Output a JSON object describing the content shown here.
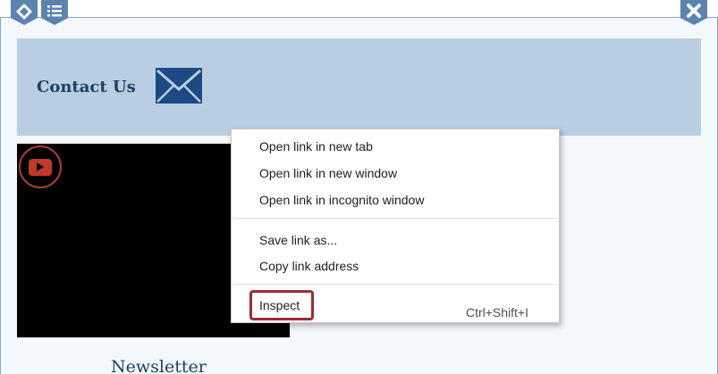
{
  "toolbar": {
    "move_icon": "move-icon",
    "list_icon": "list-icon",
    "close_icon": "close-icon",
    "badge_color": "#5b83ad"
  },
  "contact": {
    "title": "Contact Us",
    "icon": "envelope-icon",
    "banner_color": "#b9cfe1"
  },
  "video": {
    "icon": "youtube-icon"
  },
  "newsletter": {
    "title": "Newsletter"
  },
  "context_menu": {
    "items": [
      {
        "label": "Open link in new tab"
      },
      {
        "label": "Open link in new window"
      },
      {
        "label": "Open link in incognito window"
      },
      {
        "label": "Save link as..."
      },
      {
        "label": "Copy link address"
      },
      {
        "label": "Inspect",
        "shortcut": "Ctrl+Shift+I",
        "highlighted": true
      }
    ],
    "highlight_color": "#9c2b35"
  }
}
